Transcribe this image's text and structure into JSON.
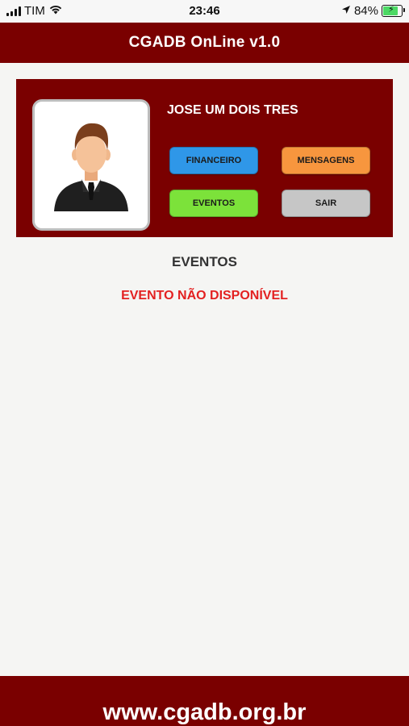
{
  "status_bar": {
    "carrier": "TIM",
    "time": "23:46",
    "battery": "84%",
    "battery_level": 0.84,
    "icons": [
      "signal-icon",
      "wifi-icon",
      "location-arrow-icon",
      "battery-icon"
    ]
  },
  "header": {
    "title": "CGADB OnLine v1.0"
  },
  "profile": {
    "name": "JOSE UM DOIS TRES",
    "avatar_icon": "user-avatar-icon",
    "buttons": {
      "financeiro": "FINANCEIRO",
      "mensagens": "MENSAGENS",
      "eventos": "EVENTOS",
      "sair": "SAIR"
    }
  },
  "content": {
    "section_title": "EVENTOS",
    "status_message": "EVENTO NÃO DISPONÍVEL"
  },
  "footer": {
    "link": "www.cgadb.org.br"
  },
  "colors": {
    "brand": "#7a0000",
    "financeiro": "#2f97e8",
    "mensagens": "#f7963e",
    "eventos": "#7ce23a",
    "sair": "#c6c6c6",
    "error_text": "#e32121"
  }
}
